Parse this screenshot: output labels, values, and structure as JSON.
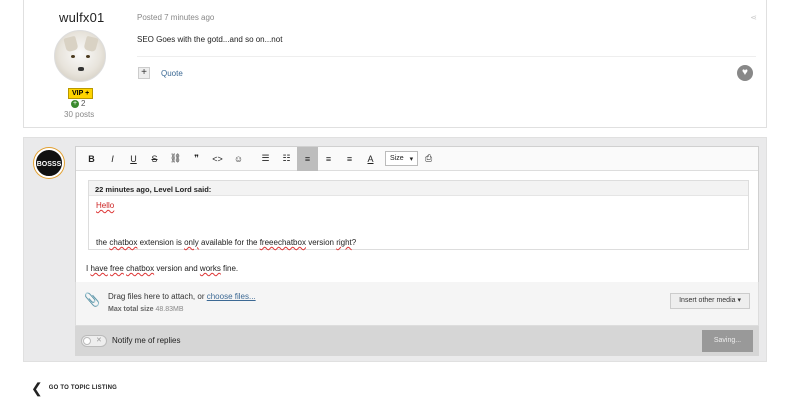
{
  "post": {
    "username": "wulfx01",
    "badge": "VIP +",
    "reputation": "2",
    "post_count": "30 posts",
    "posted": "Posted 7 minutes ago",
    "content": "SEO Goes with the gotd...and so on...not",
    "multiquote_label": "+",
    "quote_label": "Quote"
  },
  "reply": {
    "avatar_text": "BOSSS",
    "toolbar": {
      "bold": "B",
      "italic": "I",
      "underline": "U",
      "strike": "S",
      "link": "⛓",
      "quote": "❞",
      "code": "<>",
      "emoji": "☺",
      "bullets": "☰",
      "numbered": "☷",
      "align_left": "≡",
      "align_center": "≡",
      "align_right": "≡",
      "text_color": "A",
      "size_label": "Size",
      "source": "⎙"
    },
    "quote": {
      "header": "22 minutes ago, Level Lord said:",
      "line1": "Hello",
      "line2_parts": [
        "the ",
        "chatbox",
        " extension is ",
        "only",
        " available for the ",
        "freeechatbox",
        " version ",
        "right",
        "?"
      ]
    },
    "own_text_parts": [
      "I ",
      "have",
      " ",
      "free",
      " ",
      "chatbox",
      " version and ",
      "works",
      " fine."
    ],
    "attach": {
      "drag_text": "Drag files here to attach, or ",
      "choose_label": "choose files...",
      "max_label": "Max total size",
      "max_value": "48.83MB",
      "insert_label": "Insert other media ▾"
    },
    "notify_label": "Notify me of replies",
    "saving_label": "Saving..."
  },
  "nav": {
    "back_label": "GO TO TOPIC LISTING"
  }
}
